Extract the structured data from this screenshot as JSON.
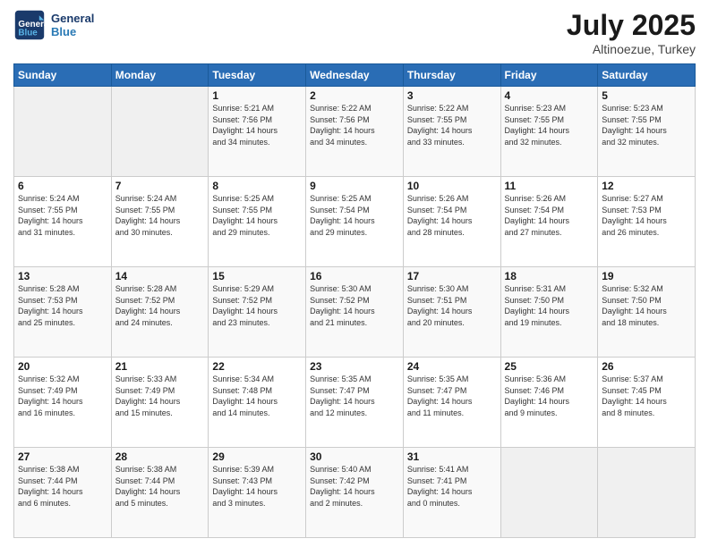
{
  "header": {
    "logo_line1": "General",
    "logo_line2": "Blue",
    "month": "July 2025",
    "location": "Altinoezue, Turkey"
  },
  "weekdays": [
    "Sunday",
    "Monday",
    "Tuesday",
    "Wednesday",
    "Thursday",
    "Friday",
    "Saturday"
  ],
  "weeks": [
    [
      {
        "day": "",
        "detail": ""
      },
      {
        "day": "",
        "detail": ""
      },
      {
        "day": "1",
        "detail": "Sunrise: 5:21 AM\nSunset: 7:56 PM\nDaylight: 14 hours\nand 34 minutes."
      },
      {
        "day": "2",
        "detail": "Sunrise: 5:22 AM\nSunset: 7:56 PM\nDaylight: 14 hours\nand 34 minutes."
      },
      {
        "day": "3",
        "detail": "Sunrise: 5:22 AM\nSunset: 7:55 PM\nDaylight: 14 hours\nand 33 minutes."
      },
      {
        "day": "4",
        "detail": "Sunrise: 5:23 AM\nSunset: 7:55 PM\nDaylight: 14 hours\nand 32 minutes."
      },
      {
        "day": "5",
        "detail": "Sunrise: 5:23 AM\nSunset: 7:55 PM\nDaylight: 14 hours\nand 32 minutes."
      }
    ],
    [
      {
        "day": "6",
        "detail": "Sunrise: 5:24 AM\nSunset: 7:55 PM\nDaylight: 14 hours\nand 31 minutes."
      },
      {
        "day": "7",
        "detail": "Sunrise: 5:24 AM\nSunset: 7:55 PM\nDaylight: 14 hours\nand 30 minutes."
      },
      {
        "day": "8",
        "detail": "Sunrise: 5:25 AM\nSunset: 7:55 PM\nDaylight: 14 hours\nand 29 minutes."
      },
      {
        "day": "9",
        "detail": "Sunrise: 5:25 AM\nSunset: 7:54 PM\nDaylight: 14 hours\nand 29 minutes."
      },
      {
        "day": "10",
        "detail": "Sunrise: 5:26 AM\nSunset: 7:54 PM\nDaylight: 14 hours\nand 28 minutes."
      },
      {
        "day": "11",
        "detail": "Sunrise: 5:26 AM\nSunset: 7:54 PM\nDaylight: 14 hours\nand 27 minutes."
      },
      {
        "day": "12",
        "detail": "Sunrise: 5:27 AM\nSunset: 7:53 PM\nDaylight: 14 hours\nand 26 minutes."
      }
    ],
    [
      {
        "day": "13",
        "detail": "Sunrise: 5:28 AM\nSunset: 7:53 PM\nDaylight: 14 hours\nand 25 minutes."
      },
      {
        "day": "14",
        "detail": "Sunrise: 5:28 AM\nSunset: 7:52 PM\nDaylight: 14 hours\nand 24 minutes."
      },
      {
        "day": "15",
        "detail": "Sunrise: 5:29 AM\nSunset: 7:52 PM\nDaylight: 14 hours\nand 23 minutes."
      },
      {
        "day": "16",
        "detail": "Sunrise: 5:30 AM\nSunset: 7:52 PM\nDaylight: 14 hours\nand 21 minutes."
      },
      {
        "day": "17",
        "detail": "Sunrise: 5:30 AM\nSunset: 7:51 PM\nDaylight: 14 hours\nand 20 minutes."
      },
      {
        "day": "18",
        "detail": "Sunrise: 5:31 AM\nSunset: 7:50 PM\nDaylight: 14 hours\nand 19 minutes."
      },
      {
        "day": "19",
        "detail": "Sunrise: 5:32 AM\nSunset: 7:50 PM\nDaylight: 14 hours\nand 18 minutes."
      }
    ],
    [
      {
        "day": "20",
        "detail": "Sunrise: 5:32 AM\nSunset: 7:49 PM\nDaylight: 14 hours\nand 16 minutes."
      },
      {
        "day": "21",
        "detail": "Sunrise: 5:33 AM\nSunset: 7:49 PM\nDaylight: 14 hours\nand 15 minutes."
      },
      {
        "day": "22",
        "detail": "Sunrise: 5:34 AM\nSunset: 7:48 PM\nDaylight: 14 hours\nand 14 minutes."
      },
      {
        "day": "23",
        "detail": "Sunrise: 5:35 AM\nSunset: 7:47 PM\nDaylight: 14 hours\nand 12 minutes."
      },
      {
        "day": "24",
        "detail": "Sunrise: 5:35 AM\nSunset: 7:47 PM\nDaylight: 14 hours\nand 11 minutes."
      },
      {
        "day": "25",
        "detail": "Sunrise: 5:36 AM\nSunset: 7:46 PM\nDaylight: 14 hours\nand 9 minutes."
      },
      {
        "day": "26",
        "detail": "Sunrise: 5:37 AM\nSunset: 7:45 PM\nDaylight: 14 hours\nand 8 minutes."
      }
    ],
    [
      {
        "day": "27",
        "detail": "Sunrise: 5:38 AM\nSunset: 7:44 PM\nDaylight: 14 hours\nand 6 minutes."
      },
      {
        "day": "28",
        "detail": "Sunrise: 5:38 AM\nSunset: 7:44 PM\nDaylight: 14 hours\nand 5 minutes."
      },
      {
        "day": "29",
        "detail": "Sunrise: 5:39 AM\nSunset: 7:43 PM\nDaylight: 14 hours\nand 3 minutes."
      },
      {
        "day": "30",
        "detail": "Sunrise: 5:40 AM\nSunset: 7:42 PM\nDaylight: 14 hours\nand 2 minutes."
      },
      {
        "day": "31",
        "detail": "Sunrise: 5:41 AM\nSunset: 7:41 PM\nDaylight: 14 hours\nand 0 minutes."
      },
      {
        "day": "",
        "detail": ""
      },
      {
        "day": "",
        "detail": ""
      }
    ]
  ]
}
